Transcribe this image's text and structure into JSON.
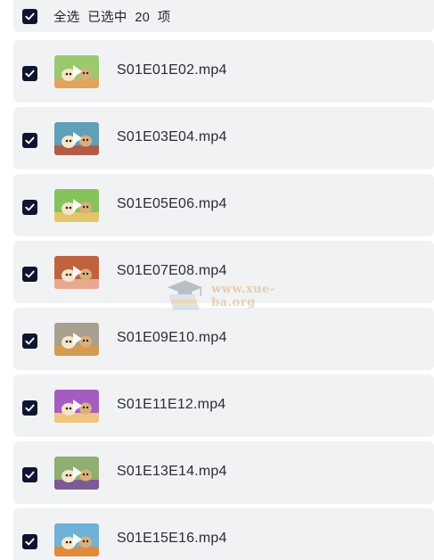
{
  "header": {
    "select_all_label": "全选",
    "selected_text": "已选中",
    "selected_count": "20",
    "count_unit": "项",
    "checked": true
  },
  "items": [
    {
      "filename": "S01E01E02.mp4",
      "checked": true,
      "thumb_bg": "#9cc86e",
      "thumb_accent": "#e0a45c"
    },
    {
      "filename": "S01E03E04.mp4",
      "checked": true,
      "thumb_bg": "#5f9fb8",
      "thumb_accent": "#b05b48"
    },
    {
      "filename": "S01E05E06.mp4",
      "checked": true,
      "thumb_bg": "#86c25c",
      "thumb_accent": "#e3c56a"
    },
    {
      "filename": "S01E07E08.mp4",
      "checked": true,
      "thumb_bg": "#c0623e",
      "thumb_accent": "#e8a990"
    },
    {
      "filename": "S01E09E10.mp4",
      "checked": true,
      "thumb_bg": "#a8a08e",
      "thumb_accent": "#d59b50"
    },
    {
      "filename": "S01E11E12.mp4",
      "checked": true,
      "thumb_bg": "#a55cc2",
      "thumb_accent": "#f0c47e"
    },
    {
      "filename": "S01E13E14.mp4",
      "checked": true,
      "thumb_bg": "#8fae72",
      "thumb_accent": "#7c5a92"
    },
    {
      "filename": "S01E15E16.mp4",
      "checked": true,
      "thumb_bg": "#6eb2d6",
      "thumb_accent": "#e08a3a"
    }
  ],
  "watermark": {
    "text": "www.xue-ba.org",
    "icon": "graduation-cap-books-icon"
  },
  "colors": {
    "checkbox": "#0f1530",
    "row_background": "#f1f2f4",
    "text": "#2a2d38"
  }
}
